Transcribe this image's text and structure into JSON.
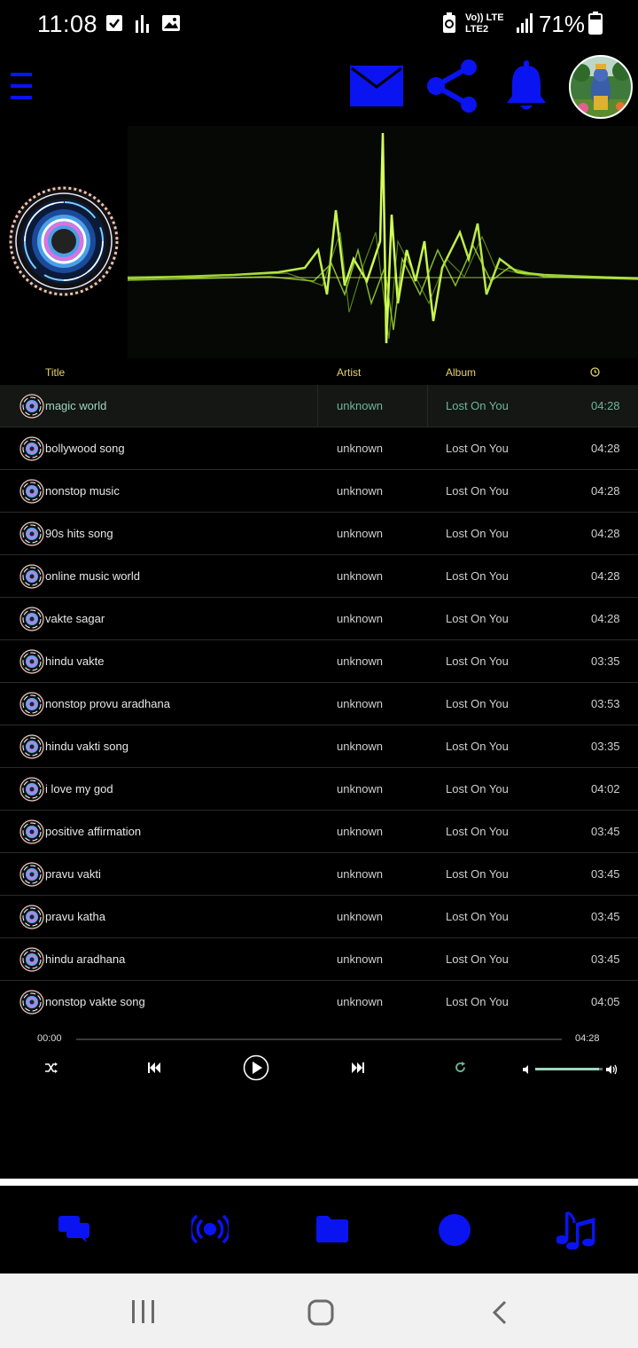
{
  "status_bar": {
    "time": "11:08",
    "network_top": "Vo)) LTE",
    "network_bottom": "LTE2",
    "battery_percent": "71%"
  },
  "header": {
    "icons": [
      "menu-icon",
      "mail-icon",
      "share-icon",
      "bell-icon",
      "avatar"
    ]
  },
  "table": {
    "columns": {
      "title": "Title",
      "artist": "Artist",
      "album": "Album",
      "duration_icon": "clock-icon"
    },
    "rows": [
      {
        "title": "magic world",
        "artist": "unknown",
        "album": "Lost On You",
        "duration": "04:28"
      },
      {
        "title": "bollywood song",
        "artist": "unknown",
        "album": "Lost On You",
        "duration": "04:28"
      },
      {
        "title": "nonstop music",
        "artist": "unknown",
        "album": "Lost On You",
        "duration": "04:28"
      },
      {
        "title": "90s hits song",
        "artist": "unknown",
        "album": "Lost On You",
        "duration": "04:28"
      },
      {
        "title": "online music world",
        "artist": "unknown",
        "album": "Lost On You",
        "duration": "04:28"
      },
      {
        "title": "vakte sagar",
        "artist": "unknown",
        "album": "Lost On You",
        "duration": "04:28"
      },
      {
        "title": "hindu vakte",
        "artist": "unknown",
        "album": "Lost On You",
        "duration": "03:35"
      },
      {
        "title": "nonstop provu aradhana",
        "artist": "unknown",
        "album": "Lost On You",
        "duration": "03:53"
      },
      {
        "title": "hindu vakti song",
        "artist": "unknown",
        "album": "Lost On You",
        "duration": "03:35"
      },
      {
        "title": "i love my god",
        "artist": "unknown",
        "album": "Lost On You",
        "duration": "04:02"
      },
      {
        "title": "positive affirmation",
        "artist": "unknown",
        "album": "Lost On You",
        "duration": "03:45"
      },
      {
        "title": "pravu vakti",
        "artist": "unknown",
        "album": "Lost On You",
        "duration": "03:45"
      },
      {
        "title": "pravu katha",
        "artist": "unknown",
        "album": "Lost On You",
        "duration": "03:45"
      },
      {
        "title": "hindu aradhana",
        "artist": "unknown",
        "album": "Lost On You",
        "duration": "03:45"
      },
      {
        "title": "nonstop vakte song",
        "artist": "unknown",
        "album": "Lost On You",
        "duration": "04:05"
      }
    ]
  },
  "player": {
    "elapsed": "00:00",
    "total": "04:28",
    "progress": 0,
    "volume": 0.95
  },
  "bottom_nav": {
    "icons": [
      "chat-icon",
      "broadcast-icon",
      "folder-icon",
      "circle-icon",
      "music-notes-icon"
    ]
  },
  "colors": {
    "accent_blue": "#0a14f0",
    "header_gold": "#e8d36a",
    "active_green": "#6fb59a"
  }
}
